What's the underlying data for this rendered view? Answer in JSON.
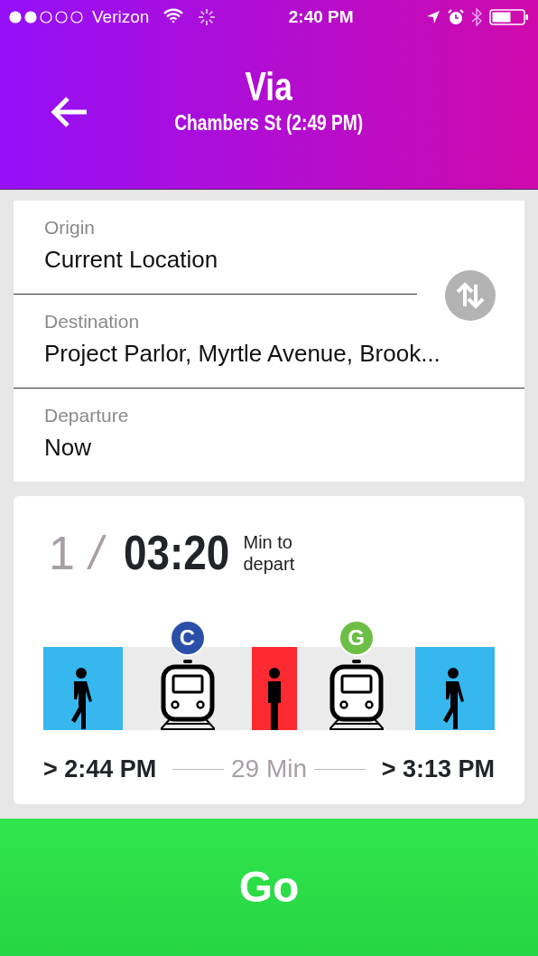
{
  "status_bar": {
    "carrier": "Verizon",
    "time": "2:40 PM"
  },
  "header": {
    "title": "Via",
    "subtitle": "Chambers St (2:49 PM)"
  },
  "fields": [
    {
      "label": "Origin",
      "value": "Current Location"
    },
    {
      "label": "Destination",
      "value": "Project Parlor, Myrtle Avenue, Brook..."
    },
    {
      "label": "Departure",
      "value": "Now"
    }
  ],
  "trip": {
    "index": "1",
    "separator": "/",
    "countdown": "03:20",
    "countdown_label": "Min to depart",
    "segments": [
      {
        "kind": "walk",
        "color": "#36b7ee"
      },
      {
        "kind": "train",
        "color": "#ebebeb",
        "line": {
          "label": "C",
          "color": "#2a4fa8"
        }
      },
      {
        "kind": "wait",
        "color": "#fb2a30"
      },
      {
        "kind": "train",
        "color": "#ebebeb",
        "line": {
          "label": "G",
          "color": "#6cbf44"
        }
      },
      {
        "kind": "walk",
        "color": "#36b7ee"
      }
    ],
    "start": "> 2:44 PM",
    "duration": "29 Min",
    "end": "> 3:13 PM"
  },
  "go_button": "Go"
}
